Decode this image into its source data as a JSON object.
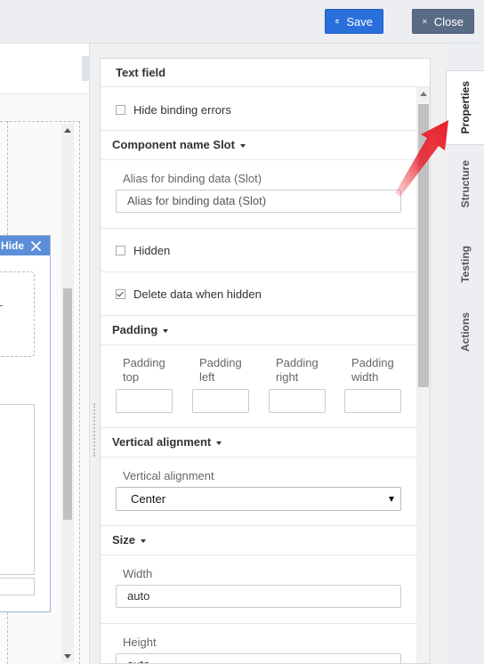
{
  "toolbar": {
    "save_label": "Save",
    "close_label": "Close"
  },
  "left": {
    "hide_label": "Hide"
  },
  "props": {
    "title": "Text field",
    "hide_binding_errors": {
      "label": "Hide binding errors",
      "checked": false
    },
    "component_name_section": "Component name Slot",
    "alias_label": "Alias for binding data (Slot)",
    "alias_value": "Alias for binding data  (Slot)",
    "hidden": {
      "label": "Hidden",
      "checked": false
    },
    "delete_when_hidden": {
      "label": "Delete data when hidden",
      "checked": true
    },
    "padding_section": "Padding",
    "padding": [
      {
        "line1": "Padding",
        "line2": "top",
        "value": ""
      },
      {
        "line1": "Padding",
        "line2": "left",
        "value": ""
      },
      {
        "line1": "Padding",
        "line2": "right",
        "value": ""
      },
      {
        "line1": "Padding",
        "line2": "width",
        "value": ""
      }
    ],
    "vertical_alignment_section": "Vertical alignment",
    "vertical_alignment_label": "Vertical alignment",
    "vertical_alignment_value": "Center",
    "size_section": "Size",
    "width_label": "Width",
    "width_value": "auto",
    "height_label": "Height",
    "height_value": "auto"
  },
  "tabs": [
    {
      "label": "Properties",
      "active": true
    },
    {
      "label": "Structure",
      "active": false
    },
    {
      "label": "Testing",
      "active": false
    },
    {
      "label": "Actions",
      "active": false
    }
  ],
  "colors": {
    "save": "#2a6fdb",
    "close": "#5a6b86",
    "hide_bar": "#5b8fd9",
    "annotation_arrow": "#e8202a"
  }
}
